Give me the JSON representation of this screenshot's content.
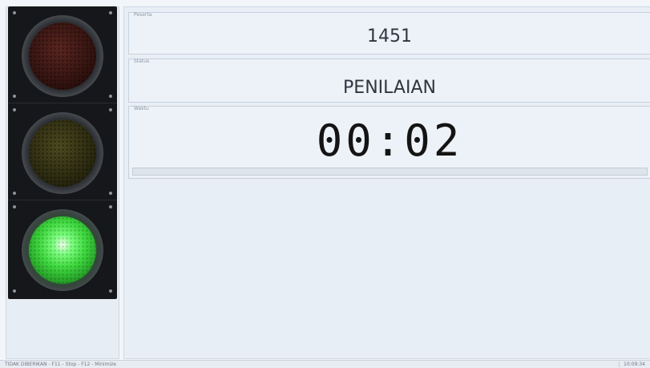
{
  "peserta": {
    "legend": "Peserta",
    "value": "1451"
  },
  "status": {
    "legend": "Status",
    "value": "PENILAIAN"
  },
  "waktu": {
    "legend": "Waktu",
    "value": "00:02",
    "progress_percent": 0
  },
  "traffic_light": {
    "active": "green",
    "lamps": [
      "red",
      "yellow",
      "green"
    ]
  },
  "status_bar": {
    "hint": "TIDAK DIBERIKAN - F11 - Stop - F12 - Minimize",
    "time": "10:09:34"
  },
  "colors": {
    "lamp_green_on": "#5cf05c",
    "lamp_red_off": "#3b1613",
    "lamp_yellow_off": "#3b3a17",
    "panel_bg": "#edf2f8"
  }
}
